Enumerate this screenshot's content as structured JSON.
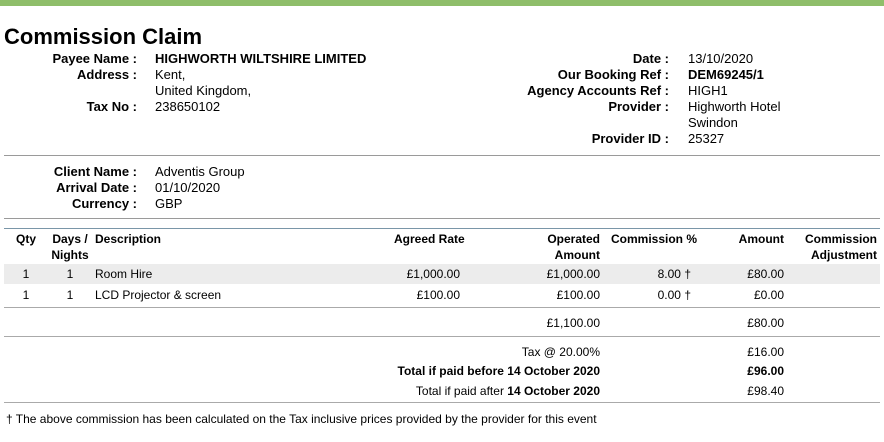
{
  "title": "Commission Claim",
  "payee": {
    "name_label": "Payee Name :",
    "name": "HIGHWORTH WILTSHIRE LIMITED",
    "address_label": "Address :",
    "address_line1": "Kent,",
    "address_line2": "United Kingdom,",
    "tax_label": "Tax No :",
    "tax_no": "238650102"
  },
  "booking": {
    "date_label": "Date :",
    "date": "13/10/2020",
    "booking_ref_label": "Our Booking Ref :",
    "booking_ref": "DEM69245/1",
    "agency_ref_label": "Agency Accounts Ref :",
    "agency_ref": "HIGH1",
    "provider_label": "Provider :",
    "provider_line1": "Highworth Hotel",
    "provider_line2": "Swindon",
    "provider_id_label": "Provider ID :",
    "provider_id": "25327"
  },
  "client": {
    "name_label": "Client Name :",
    "name": "Adventis Group",
    "arrival_label": "Arrival Date :",
    "arrival": "01/10/2020",
    "currency_label": "Currency :",
    "currency": "GBP"
  },
  "table": {
    "headers": {
      "qty": "Qty",
      "days_line1": "Days /",
      "days_line2": "Nights",
      "description": "Description",
      "agreed_rate": "Agreed Rate",
      "operated_line1": "Operated",
      "operated_line2": "Amount",
      "commission_pct": "Commission %",
      "amount": "Amount",
      "adjustment_line1": "Commission",
      "adjustment_line2": "Adjustment"
    },
    "rows": [
      {
        "qty": "1",
        "days": "1",
        "description": "Room Hire",
        "agreed_rate": "£1,000.00",
        "operated_amount": "£1,000.00",
        "commission_pct": "8.00 †",
        "amount": "£80.00",
        "adjustment": ""
      },
      {
        "qty": "1",
        "days": "1",
        "description": "LCD Projector & screen",
        "agreed_rate": "£100.00",
        "operated_amount": "£100.00",
        "commission_pct": "0.00 †",
        "amount": "£0.00",
        "adjustment": ""
      }
    ],
    "subtotal_operated": "£1,100.00",
    "subtotal_amount": "£80.00"
  },
  "totals": {
    "tax_label": "Tax @ 20.00%",
    "tax_amount": "£16.00",
    "before_label_prefix": "Total if paid before ",
    "before_date": "14 October 2020",
    "before_amount": "£96.00",
    "after_label_prefix": "Total if paid after ",
    "after_date": "14 October 2020",
    "after_amount": "£98.40"
  },
  "footnote": "† The above commission has been calculated on the Tax inclusive prices provided by the provider for this event",
  "colors": {
    "top_bar": "#8fbe6a",
    "row_shade": "#ececec",
    "rule_blue": "#7a96a8"
  }
}
